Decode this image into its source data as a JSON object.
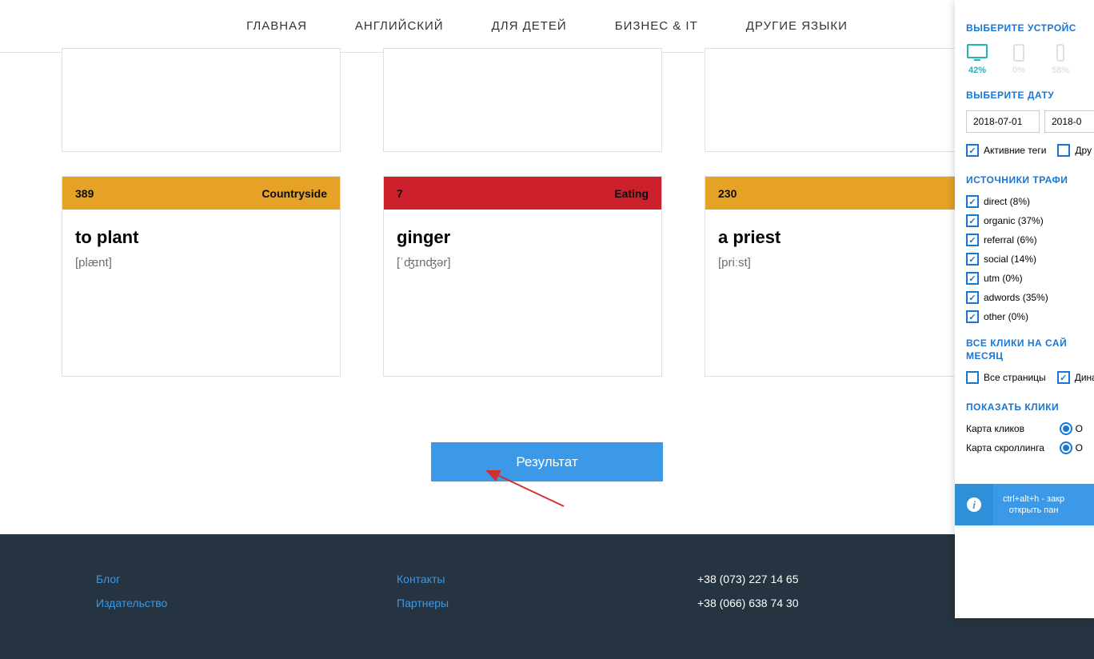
{
  "nav": {
    "items": [
      "ГЛАВНАЯ",
      "АНГЛИЙСКИЙ",
      "ДЛЯ ДЕТЕЙ",
      "БИЗНЕС & IT",
      "ДРУГИЕ ЯЗЫКИ"
    ]
  },
  "cards": [
    {
      "number": "389",
      "category": "Countryside",
      "word": "to plant",
      "ipa": "[plænt]",
      "color": "orange"
    },
    {
      "number": "7",
      "category": "Eating",
      "word": "ginger",
      "ipa": "[ˈʤɪnʤər]",
      "color": "red"
    },
    {
      "number": "230",
      "category": "",
      "word": "a priest",
      "ipa": "[priːst]",
      "color": "orange"
    }
  ],
  "result_button": "Результат",
  "footer": {
    "col1": [
      "Блог",
      "Издательство"
    ],
    "col2": [
      "Контакты",
      "Партнеры"
    ],
    "phones": [
      "+38 (073) 227 14 65",
      "+38 (066) 638 74 30"
    ]
  },
  "sidebar": {
    "device_title": "ВЫБЕРИТЕ УСТРОЙС",
    "devices": [
      {
        "pct": "42%",
        "active": true
      },
      {
        "pct": "0%",
        "active": false
      },
      {
        "pct": "58%",
        "active": false
      }
    ],
    "date_title": "ВЫБЕРИТЕ ДАТУ",
    "date_from": "2018-07-01",
    "date_to": "2018-0",
    "tags": {
      "active": "Активние теги",
      "other": "Дру"
    },
    "traffic_title": "ИСТОЧНИКИ ТРАФИ",
    "traffic": [
      "direct (8%)",
      "organic (37%)",
      "referral (6%)",
      "social (14%)",
      "utm (0%)",
      "adwords (35%)",
      "other (0%)"
    ],
    "clicks_title": "ВСЕ КЛИКИ НА САЙ",
    "clicks_sub": "МЕСЯЦ",
    "all_pages": "Все страницы",
    "dynamic": "Динам",
    "show_title": "ПОКАЗАТЬ КЛИКИ",
    "click_map": "Карта кликов",
    "scroll_map": "Карта скроллинга",
    "click_map_opt": "O",
    "scroll_map_opt": "O",
    "info": "ctrl+alt+h - закр",
    "info2": "открыть пан"
  }
}
